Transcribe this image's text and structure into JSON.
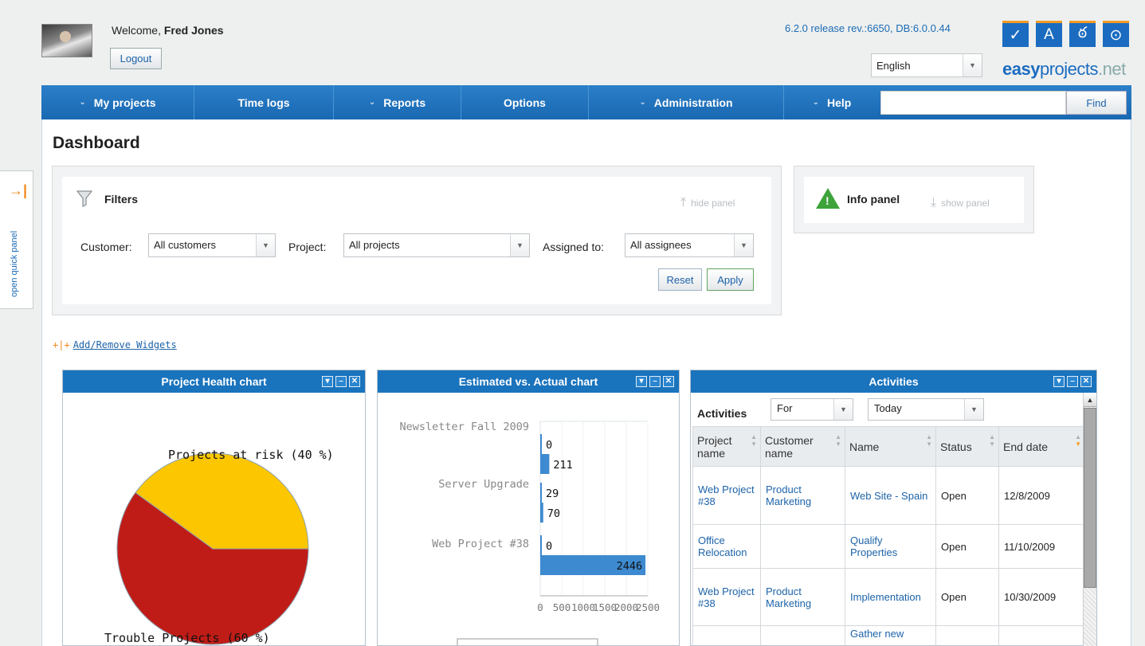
{
  "header": {
    "welcome_prefix": "Welcome,",
    "user_name": "Fred Jones",
    "logout_label": "Logout",
    "release_info": "6.2.0 release rev.:6650, DB:6.0.0.44",
    "language": "English",
    "logo_bold": "easy",
    "logo_rest": "projects",
    "logo_tld": ".net",
    "logo_icons": [
      "✓",
      "A",
      "ఠ",
      "⊙"
    ]
  },
  "nav": {
    "items": [
      {
        "label": "My projects",
        "has_dropdown": true
      },
      {
        "label": "Time logs",
        "has_dropdown": false
      },
      {
        "label": "Reports",
        "has_dropdown": true
      },
      {
        "label": "Options",
        "has_dropdown": false
      },
      {
        "label": "Administration",
        "has_dropdown": true
      },
      {
        "label": "Help",
        "has_dropdown": true
      }
    ],
    "search_value": "",
    "find_label": "Find"
  },
  "page_title": "Dashboard",
  "quick_panel_label": "open quick panel",
  "filters": {
    "title": "Filters",
    "hide_panel": "hide panel",
    "customer_label": "Customer:",
    "customer_value": "All customers",
    "project_label": "Project:",
    "project_value": "All projects",
    "assigned_label": "Assigned to:",
    "assigned_value": "All assignees",
    "reset_label": "Reset",
    "apply_label": "Apply"
  },
  "info_panel": {
    "title": "Info panel",
    "show_panel": "show panel"
  },
  "add_widgets_label": "Add/Remove Widgets",
  "widgets": {
    "health": {
      "title": "Project Health chart"
    },
    "estimated": {
      "title": "Estimated vs. Actual chart"
    },
    "activities": {
      "title": "Activities"
    }
  },
  "chart_data": [
    {
      "type": "pie",
      "title": "Project Health chart",
      "slices": [
        {
          "label": "Projects at risk (40 %)",
          "value": 40,
          "color": "#fcc600"
        },
        {
          "label": "Trouble Projects (60 %)",
          "value": 60,
          "color": "#c01c17"
        }
      ]
    },
    {
      "type": "bar",
      "orientation": "horizontal",
      "title": "Estimated vs. Actual chart",
      "categories": [
        "Newsletter Fall 2009",
        "Server Upgrade",
        "Web Project #38"
      ],
      "series": [
        {
          "values": [
            0,
            29,
            0
          ]
        },
        {
          "values": [
            211,
            70,
            2446
          ]
        }
      ],
      "xlim": [
        0,
        2500
      ],
      "xticks": [
        "0",
        "500",
        "1000",
        "1500",
        "2000",
        "2500"
      ],
      "colors": {
        "bar": "#3d8ad0"
      }
    }
  ],
  "activities": {
    "label": "Activities",
    "for_value": "For",
    "period_value": "Today",
    "columns": [
      "Project name",
      "Customer name",
      "Name",
      "Status",
      "End date"
    ],
    "rows": [
      {
        "project": "Web Project #38",
        "customer": "Product Marketing",
        "name": "Web Site - Spain",
        "status": "Open",
        "end": "12/8/2009"
      },
      {
        "project": "Office Relocation",
        "customer": "",
        "name": "Qualify Properties",
        "status": "Open",
        "end": "11/10/2009"
      },
      {
        "project": "Web Project #38",
        "customer": "Product Marketing",
        "name": "Implementation",
        "status": "Open",
        "end": "10/30/2009"
      },
      {
        "project": "",
        "customer": "",
        "name": "Gather new",
        "status": "",
        "end": ""
      }
    ]
  }
}
